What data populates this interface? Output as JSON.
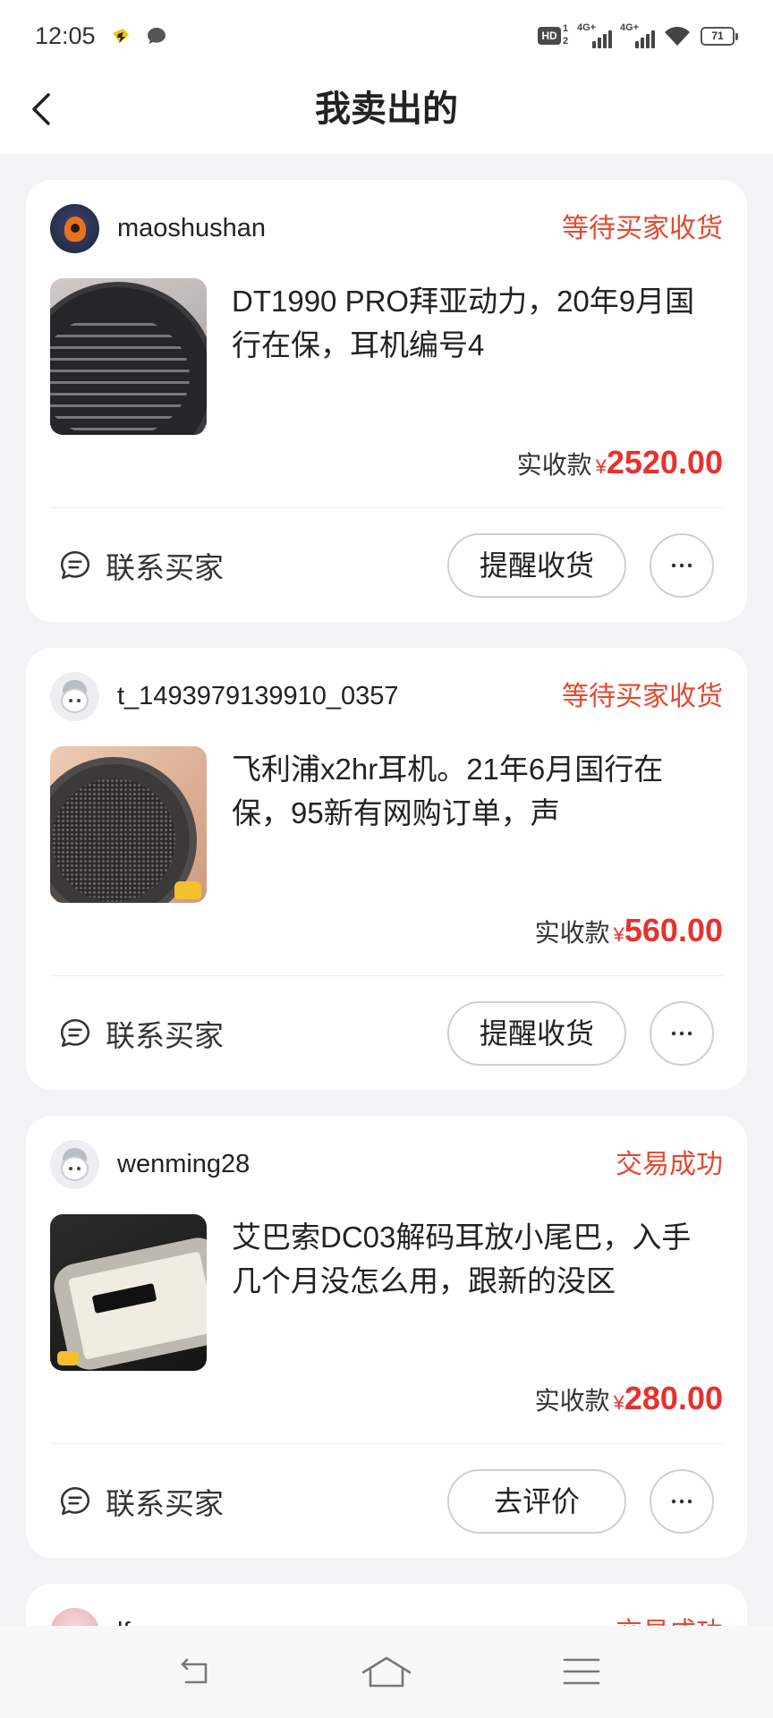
{
  "status_bar": {
    "time": "12:05",
    "hd_label": "HD",
    "hd_indices": [
      "1",
      "2"
    ],
    "network_1": "4G+",
    "network_2": "4G+",
    "battery_level": "71",
    "icons": [
      "notification-app-icon",
      "message-icon",
      "hd-voice-icon",
      "signal-icon",
      "signal-icon",
      "wifi-icon",
      "battery-icon"
    ]
  },
  "header": {
    "back_icon": "chevron-left-icon",
    "title": "我卖出的"
  },
  "orders": [
    {
      "buyer_name": "maoshushan",
      "status": "等待买家收货",
      "product_title": "DT1990 PRO拜亚动力，20年9月国行在保，耳机编号4",
      "price_label": "实收款",
      "currency": "¥",
      "price": "2520.00",
      "contact_label": "联系买家",
      "action_label": "提醒收货"
    },
    {
      "buyer_name": "t_1493979139910_0357",
      "status": "等待买家收货",
      "product_title": "飞利浦x2hr耳机。21年6月国行在保，95新有网购订单，声",
      "price_label": "实收款",
      "currency": "¥",
      "price": "560.00",
      "contact_label": "联系买家",
      "action_label": "提醒收货"
    },
    {
      "buyer_name": "wenming28",
      "status": "交易成功",
      "product_title": "艾巴索DC03解码耳放小尾巴，入手几个月没怎么用，跟新的没区",
      "price_label": "实收款",
      "currency": "¥",
      "price": "280.00",
      "contact_label": "联系买家",
      "action_label": "去评价"
    },
    {
      "buyer_name": "lf",
      "status": "交易成功"
    }
  ],
  "bottom_nav": {
    "icons": [
      "back-icon",
      "home-icon",
      "menu-icon"
    ]
  },
  "colors": {
    "accent_red": "#e8472f",
    "price_red": "#e5322d",
    "page_background": "#f2f3f5",
    "card_background": "#ffffff"
  }
}
